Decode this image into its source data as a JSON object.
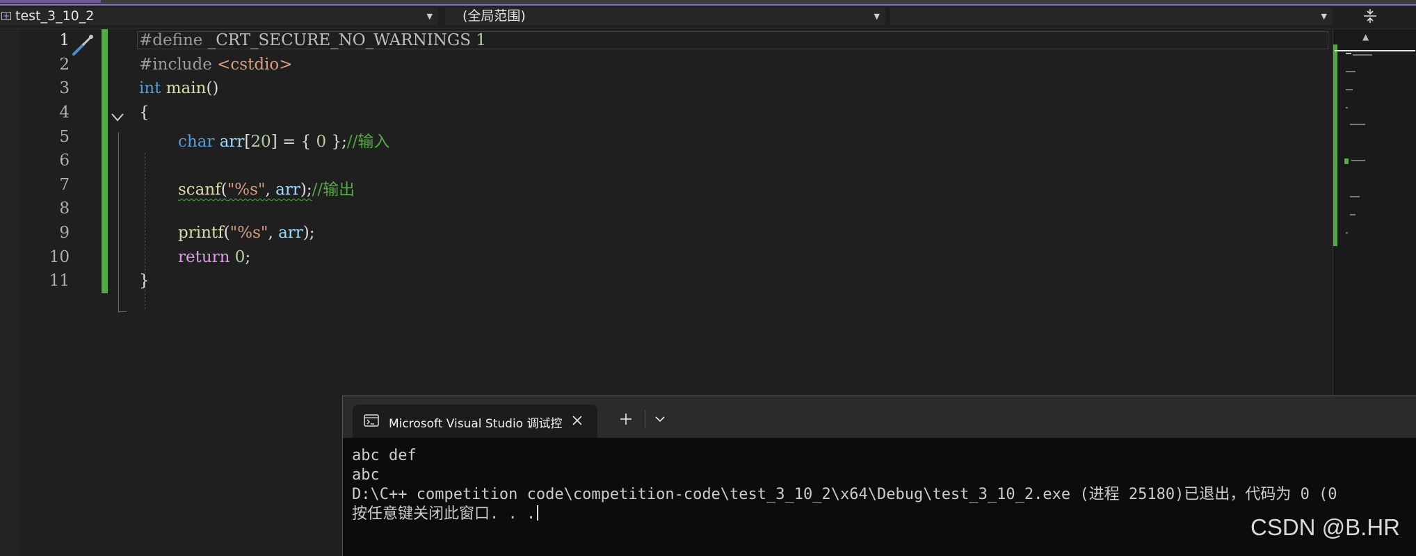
{
  "navbar": {
    "project": "test_3_10_2",
    "scope": "(全局范围)",
    "member": ""
  },
  "editor": {
    "line_numbers": [
      "1",
      "2",
      "3",
      "4",
      "5",
      "6",
      "7",
      "8",
      "9",
      "10",
      "11"
    ],
    "lines": {
      "l1": {
        "pp": "#define",
        "macro": "_CRT_SECURE_NO_WARNINGS",
        "num": "1"
      },
      "l2": {
        "pp": "#include",
        "header": "<cstdio>"
      },
      "l3": {
        "kw": "int",
        "fn": "main",
        "rest": "()"
      },
      "l4": {
        "brace": "{"
      },
      "l5": {
        "kw": "char",
        "var": "arr",
        "bracket_open": "[",
        "num": "20",
        "rest": "] = { ",
        "zero": "0",
        "end": " };",
        "comment": "//输入"
      },
      "l7": {
        "fn": "scanf",
        "p1": "(",
        "str": "\"%s\"",
        "comma": ", ",
        "var": "arr",
        "end": ");",
        "comment": "//输出"
      },
      "l9": {
        "fn": "printf",
        "p1": "(",
        "str": "\"%s\"",
        "comma": ", ",
        "var": "arr",
        "end": ");"
      },
      "l10": {
        "kw": "return",
        "num": "0",
        "end": ";"
      },
      "l11": {
        "brace": "}"
      }
    }
  },
  "console": {
    "tab_title": "Microsoft Visual Studio 调试控",
    "lines": [
      "abc def",
      "abc",
      "D:\\C++ competition code\\competition-code\\test_3_10_2\\x64\\Debug\\test_3_10_2.exe (进程 25180)已退出，代码为 0 (0",
      "按任意键关闭此窗口. . ."
    ]
  },
  "watermark": "CSDN @B.HR",
  "colors": {
    "background": "#1f1f1f",
    "change_bar": "#57a64a",
    "keyword": "#569cd6",
    "control_keyword": "#d8a0df",
    "function": "#dcdcaa",
    "string": "#d69d85",
    "comment": "#57a64a",
    "variable": "#9cdcfe",
    "number": "#b5cea8"
  }
}
